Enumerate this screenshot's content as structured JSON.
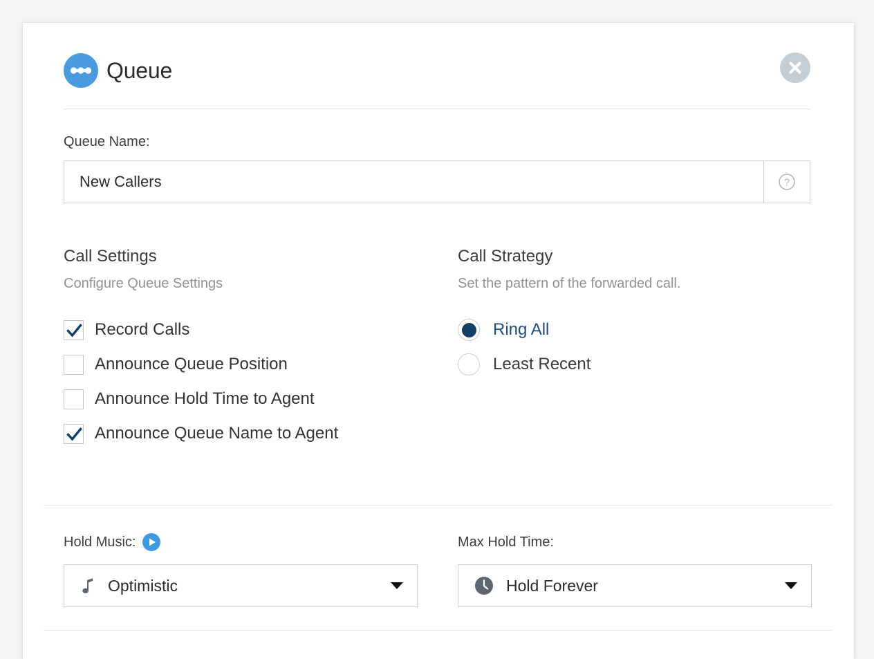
{
  "modal": {
    "title": "Queue",
    "icon": "queue-icon",
    "close_icon": "close-icon"
  },
  "queue_name": {
    "label": "Queue Name:",
    "value": "New Callers",
    "placeholder": "Queue Name",
    "help_icon": "help-circle-icon"
  },
  "call_settings": {
    "title": "Call Settings",
    "subtitle": "Configure Queue Settings",
    "options": [
      {
        "label": "Record Calls",
        "checked": true
      },
      {
        "label": "Announce Queue Position",
        "checked": false
      },
      {
        "label": "Announce Hold Time to Agent",
        "checked": false
      },
      {
        "label": "Announce Queue Name to Agent",
        "checked": true
      }
    ]
  },
  "call_strategy": {
    "title": "Call Strategy",
    "subtitle": "Set the pattern of the forwarded call.",
    "options": [
      {
        "label": "Ring All",
        "selected": true
      },
      {
        "label": "Least Recent",
        "selected": false
      }
    ]
  },
  "hold_music": {
    "label": "Hold Music:",
    "play_icon": "play-icon",
    "select_icon": "music-note-icon",
    "value": "Optimistic",
    "caret_icon": "chevron-down-icon"
  },
  "max_hold_time": {
    "label": "Max Hold Time:",
    "select_icon": "clock-icon",
    "value": "Hold Forever",
    "caret_icon": "chevron-down-icon"
  },
  "colors": {
    "brand_blue": "#4a9ade",
    "navy": "#123f66",
    "link_navy": "#1d4f7c",
    "border_grey": "#cfcfcf",
    "muted_text": "#8e9296",
    "close_grey": "#c3ced6"
  }
}
